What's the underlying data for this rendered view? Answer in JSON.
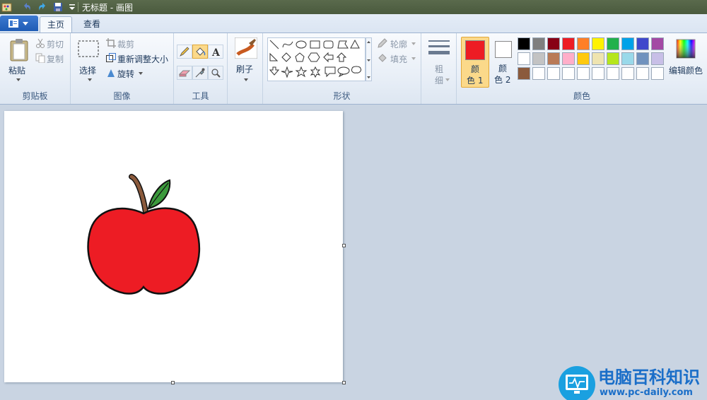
{
  "window": {
    "title": "无标题 - 画图"
  },
  "tabs": [
    {
      "label": "主页"
    },
    {
      "label": "查看"
    }
  ],
  "clipboard": {
    "paste_label": "粘贴",
    "cut_label": "剪切",
    "copy_label": "复制",
    "group_label": "剪贴板"
  },
  "image": {
    "select_label": "选择",
    "crop_label": "裁剪",
    "resize_label": "重新调整大小",
    "rotate_label": "旋转",
    "group_label": "图像"
  },
  "tools": {
    "group_label": "工具"
  },
  "brushes": {
    "label": "刷子"
  },
  "shapes": {
    "outline_label": "轮廓",
    "fill_label": "填充",
    "group_label": "形状"
  },
  "size": {
    "label_top": "粗",
    "label_bottom": "细"
  },
  "colors": {
    "color1_label_top": "颜",
    "color1_label_bottom": "色 1",
    "color2_label_top": "颜",
    "color2_label_bottom": "色 2",
    "color1_value": "#ed1c24",
    "color2_value": "#ffffff",
    "edit_label": "编辑颜色",
    "group_label": "颜色",
    "palette_row1": [
      "#000000",
      "#7f7f7f",
      "#880015",
      "#ed1c24",
      "#ff7f27",
      "#fff200",
      "#22b14c",
      "#00a2e8",
      "#3f48cc",
      "#a349a4"
    ],
    "palette_row2": [
      "#ffffff",
      "#c3c3c3",
      "#b97a57",
      "#ffaec9",
      "#ffc90e",
      "#efe4b0",
      "#b5e61d",
      "#99d9ea",
      "#7092be",
      "#c8bfe7"
    ],
    "palette_row3": [
      "#8b5a3c",
      "#ffffff",
      "#ffffff",
      "#ffffff",
      "#ffffff",
      "#ffffff",
      "#ffffff",
      "#ffffff",
      "#ffffff",
      "#ffffff"
    ]
  },
  "watermark": {
    "brand": "电脑百科知识",
    "url": "www.pc-daily.com"
  }
}
